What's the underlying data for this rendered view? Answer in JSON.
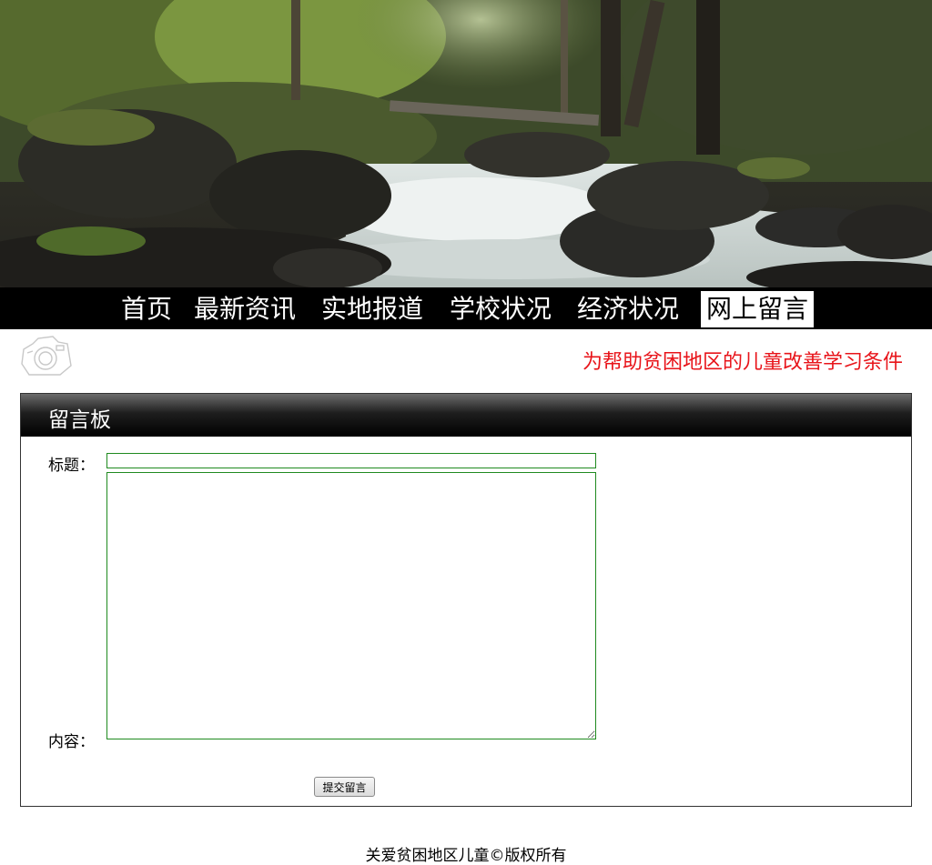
{
  "nav": {
    "items": [
      {
        "label": "首页"
      },
      {
        "label": "最新资讯"
      },
      {
        "label": "实地报道"
      },
      {
        "label": "学校状况"
      },
      {
        "label": "经济状况"
      },
      {
        "label": "网上留言",
        "active": true
      }
    ]
  },
  "notice": {
    "text": "为帮助贫困地区的儿童改善学习条件"
  },
  "board": {
    "title": "留言板",
    "title_label": "标题：",
    "content_label": "内容：",
    "title_value": "",
    "content_value": "",
    "submit_label": "提交留言"
  },
  "footer": {
    "text": "关爱贫困地区儿童©版权所有"
  },
  "colors": {
    "notice_text": "#e8141a",
    "input_border": "#1f8a1f",
    "nav_bg": "#000000"
  },
  "icons": {
    "camera": "camera-icon"
  }
}
